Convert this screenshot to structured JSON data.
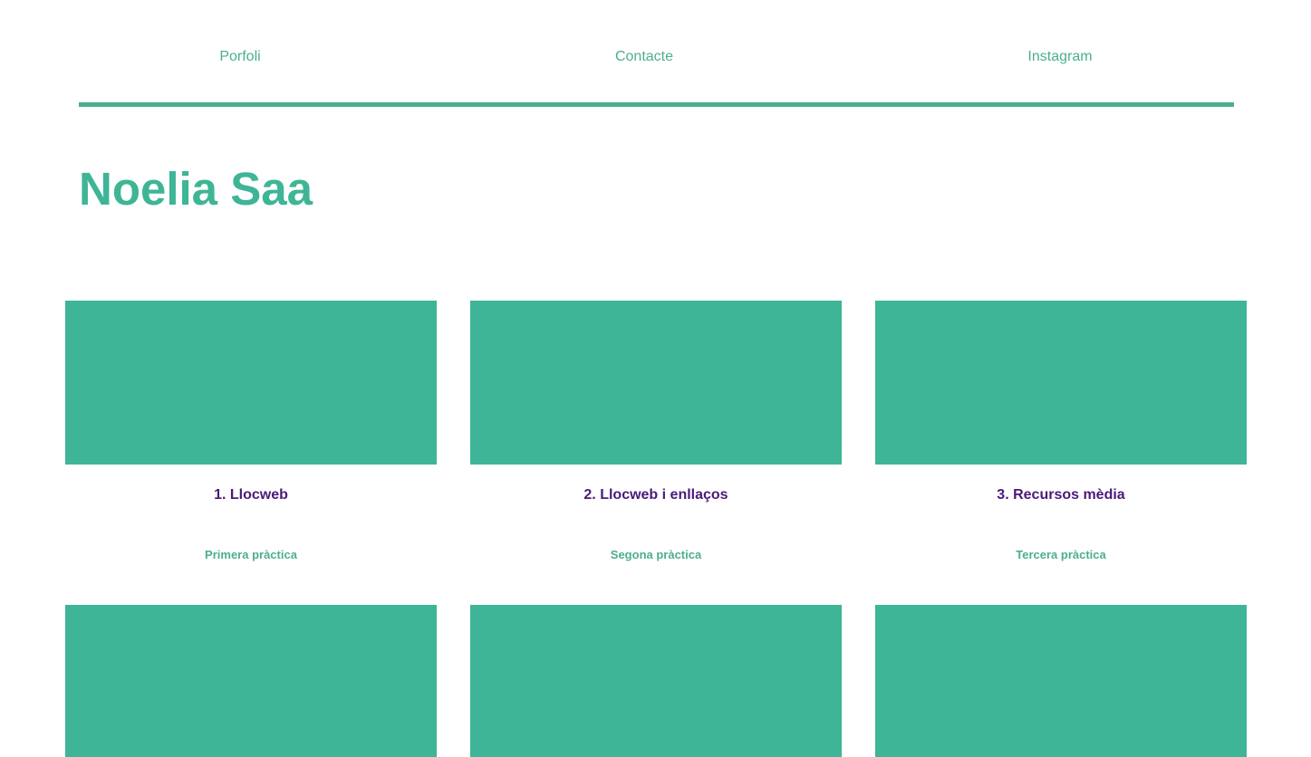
{
  "nav": {
    "items": [
      {
        "label": "Porfoli"
      },
      {
        "label": "Contacte"
      },
      {
        "label": "Instagram"
      }
    ]
  },
  "header": {
    "title": "Noelia Saa"
  },
  "cards": [
    {
      "title": "1. Llocweb",
      "subtitle": "Primera pràctica"
    },
    {
      "title": "2. Llocweb i enllaços",
      "subtitle": "Segona pràctica"
    },
    {
      "title": "3. Recursos mèdia",
      "subtitle": "Tercera pràctica"
    }
  ],
  "colors": {
    "accent": "#3eb596",
    "nav_text": "#4caf8c",
    "card_title": "#4a1a78"
  }
}
